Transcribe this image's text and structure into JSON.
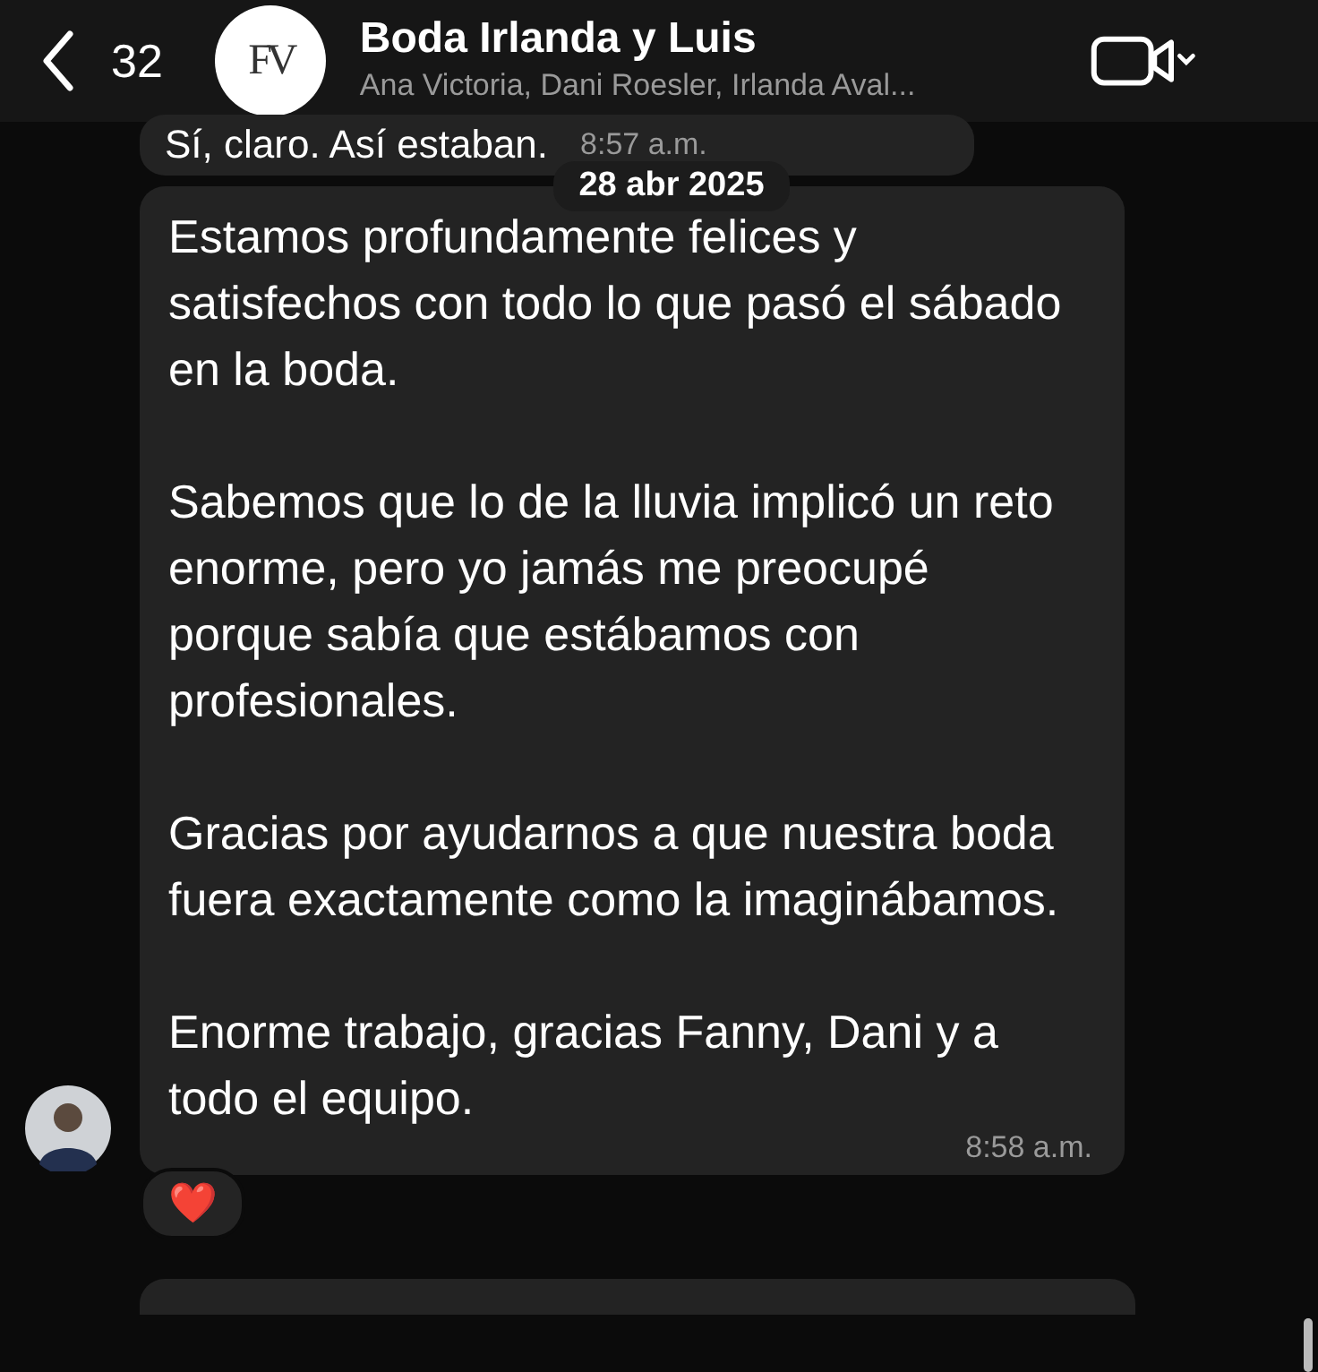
{
  "header": {
    "back_count": "32",
    "logo_text": "FV",
    "title": "Boda Irlanda y Luis",
    "subtitle": "Ana Victoria, Dani Roesler, Irlanda Aval..."
  },
  "previous_message": {
    "text": "Sí, claro. Así estaban.",
    "time": "8:57 a.m."
  },
  "date_divider": "28 abr 2025",
  "message": {
    "paragraphs": [
      "Estamos profundamente felices y satisfechos con todo lo que pasó el sábado en la boda.",
      "Sabemos que lo de la lluvia implicó un reto enorme, pero yo jamás me preocupé porque sabía que estábamos con profesionales.",
      "Gracias por ayudarnos a que nuestra boda fuera exactamente como la imaginábamos.",
      "Enorme trabajo, gracias Fanny, Dani y a todo el equipo."
    ],
    "time": "8:58 a.m.",
    "reaction": "❤️"
  }
}
